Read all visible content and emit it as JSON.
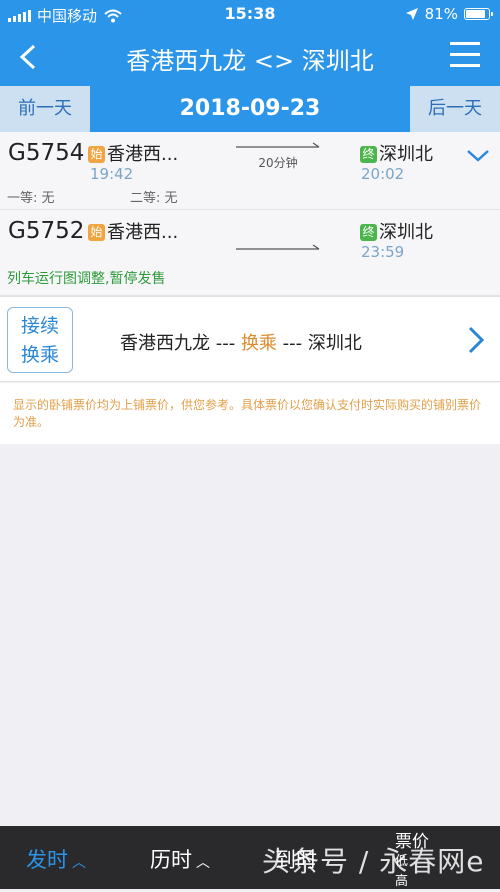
{
  "status_bar": {
    "carrier": "中国移动",
    "time": "15:38",
    "battery": "81%"
  },
  "nav": {
    "title": "香港西九龙 <> 深圳北"
  },
  "date_bar": {
    "prev_label": "前一天",
    "date": "2018-09-23",
    "next_label": "后一天"
  },
  "trains": [
    {
      "code": "G5754",
      "start_badge": "始",
      "from": "香港西...",
      "dep_time": "19:42",
      "duration": "20分钟",
      "end_badge": "终",
      "to": "深圳北",
      "arr_time": "20:02",
      "seat1": "一等: 无",
      "seat2": "二等: 无"
    },
    {
      "code": "G5752",
      "start_badge": "始",
      "from": "香港西...",
      "dep_time": "",
      "duration": "",
      "end_badge": "终",
      "to": "深圳北",
      "arr_time": "23:59",
      "notice": "列车运行图调整,暂停发售"
    }
  ],
  "transfer": {
    "tag_line1": "接续",
    "tag_line2": "换乘",
    "from": "香港西九龙",
    "sep1": " --- ",
    "mid": "换乘",
    "sep2": " --- ",
    "to": "深圳北"
  },
  "disclaimer": "显示的卧铺票价均为上铺票价，供您参考。具体票价以您确认支付时实际购买的铺别票价为准。",
  "tab_bar": {
    "dep": "发时",
    "dur": "历时",
    "arr": "到时",
    "price_line1": "票价",
    "price_line2": "低",
    "price_line3": "高"
  },
  "watermark": "头条号 / 永春网e",
  "colors": {
    "primary": "#2b95e9",
    "accent_orange": "#e08a2d",
    "notice_green": "#2e9b3a",
    "time_blue": "#7aa5c8"
  }
}
